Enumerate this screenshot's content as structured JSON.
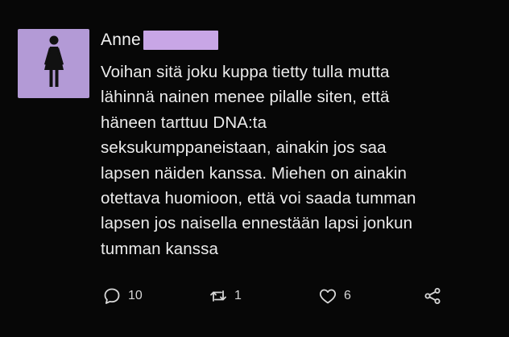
{
  "post": {
    "author": {
      "name": "Anne",
      "avatar_icon": "female-person-icon",
      "avatar_color": "#b39ad6",
      "redaction_color": "#c8a6e6"
    },
    "text_lines": [
      "Voihan sitä joku kuppa tietty tulla mutta",
      "lähinnä nainen menee pilalle siten, että",
      "häneen tarttuu DNA:ta",
      "seksukumppaneistaan, ainakin jos saa",
      "lapsen näiden kanssa. Miehen on ainakin",
      "otettava huomioon, että voi saada tumman",
      "lapsen jos naisella ennestään lapsi jonkun",
      "tumman kanssa"
    ],
    "actions": {
      "reply": {
        "icon": "reply-icon",
        "count": "10"
      },
      "repost": {
        "icon": "repost-icon",
        "count": "1"
      },
      "like": {
        "icon": "heart-icon",
        "count": "6"
      },
      "share": {
        "icon": "share-icon"
      }
    }
  }
}
